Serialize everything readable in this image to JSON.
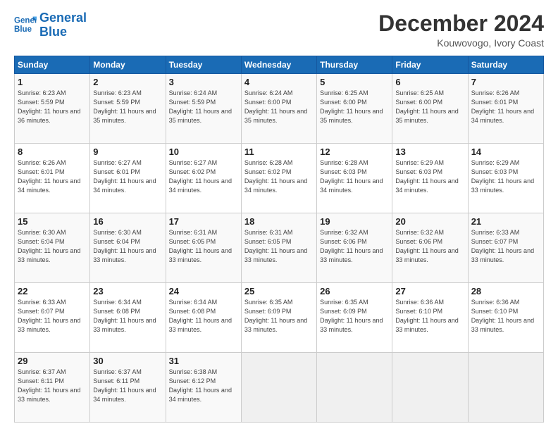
{
  "logo": {
    "line1": "General",
    "line2": "Blue"
  },
  "title": "December 2024",
  "subtitle": "Kouwovogo, Ivory Coast",
  "header": {
    "days": [
      "Sunday",
      "Monday",
      "Tuesday",
      "Wednesday",
      "Thursday",
      "Friday",
      "Saturday"
    ]
  },
  "weeks": [
    [
      {
        "day": "1",
        "sunrise": "6:23 AM",
        "sunset": "5:59 PM",
        "daylight": "11 hours and 36 minutes."
      },
      {
        "day": "2",
        "sunrise": "6:23 AM",
        "sunset": "5:59 PM",
        "daylight": "11 hours and 35 minutes."
      },
      {
        "day": "3",
        "sunrise": "6:24 AM",
        "sunset": "5:59 PM",
        "daylight": "11 hours and 35 minutes."
      },
      {
        "day": "4",
        "sunrise": "6:24 AM",
        "sunset": "6:00 PM",
        "daylight": "11 hours and 35 minutes."
      },
      {
        "day": "5",
        "sunrise": "6:25 AM",
        "sunset": "6:00 PM",
        "daylight": "11 hours and 35 minutes."
      },
      {
        "day": "6",
        "sunrise": "6:25 AM",
        "sunset": "6:00 PM",
        "daylight": "11 hours and 35 minutes."
      },
      {
        "day": "7",
        "sunrise": "6:26 AM",
        "sunset": "6:01 PM",
        "daylight": "11 hours and 34 minutes."
      }
    ],
    [
      {
        "day": "8",
        "sunrise": "6:26 AM",
        "sunset": "6:01 PM",
        "daylight": "11 hours and 34 minutes."
      },
      {
        "day": "9",
        "sunrise": "6:27 AM",
        "sunset": "6:01 PM",
        "daylight": "11 hours and 34 minutes."
      },
      {
        "day": "10",
        "sunrise": "6:27 AM",
        "sunset": "6:02 PM",
        "daylight": "11 hours and 34 minutes."
      },
      {
        "day": "11",
        "sunrise": "6:28 AM",
        "sunset": "6:02 PM",
        "daylight": "11 hours and 34 minutes."
      },
      {
        "day": "12",
        "sunrise": "6:28 AM",
        "sunset": "6:03 PM",
        "daylight": "11 hours and 34 minutes."
      },
      {
        "day": "13",
        "sunrise": "6:29 AM",
        "sunset": "6:03 PM",
        "daylight": "11 hours and 34 minutes."
      },
      {
        "day": "14",
        "sunrise": "6:29 AM",
        "sunset": "6:03 PM",
        "daylight": "11 hours and 33 minutes."
      }
    ],
    [
      {
        "day": "15",
        "sunrise": "6:30 AM",
        "sunset": "6:04 PM",
        "daylight": "11 hours and 33 minutes."
      },
      {
        "day": "16",
        "sunrise": "6:30 AM",
        "sunset": "6:04 PM",
        "daylight": "11 hours and 33 minutes."
      },
      {
        "day": "17",
        "sunrise": "6:31 AM",
        "sunset": "6:05 PM",
        "daylight": "11 hours and 33 minutes."
      },
      {
        "day": "18",
        "sunrise": "6:31 AM",
        "sunset": "6:05 PM",
        "daylight": "11 hours and 33 minutes."
      },
      {
        "day": "19",
        "sunrise": "6:32 AM",
        "sunset": "6:06 PM",
        "daylight": "11 hours and 33 minutes."
      },
      {
        "day": "20",
        "sunrise": "6:32 AM",
        "sunset": "6:06 PM",
        "daylight": "11 hours and 33 minutes."
      },
      {
        "day": "21",
        "sunrise": "6:33 AM",
        "sunset": "6:07 PM",
        "daylight": "11 hours and 33 minutes."
      }
    ],
    [
      {
        "day": "22",
        "sunrise": "6:33 AM",
        "sunset": "6:07 PM",
        "daylight": "11 hours and 33 minutes."
      },
      {
        "day": "23",
        "sunrise": "6:34 AM",
        "sunset": "6:08 PM",
        "daylight": "11 hours and 33 minutes."
      },
      {
        "day": "24",
        "sunrise": "6:34 AM",
        "sunset": "6:08 PM",
        "daylight": "11 hours and 33 minutes."
      },
      {
        "day": "25",
        "sunrise": "6:35 AM",
        "sunset": "6:09 PM",
        "daylight": "11 hours and 33 minutes."
      },
      {
        "day": "26",
        "sunrise": "6:35 AM",
        "sunset": "6:09 PM",
        "daylight": "11 hours and 33 minutes."
      },
      {
        "day": "27",
        "sunrise": "6:36 AM",
        "sunset": "6:10 PM",
        "daylight": "11 hours and 33 minutes."
      },
      {
        "day": "28",
        "sunrise": "6:36 AM",
        "sunset": "6:10 PM",
        "daylight": "11 hours and 33 minutes."
      }
    ],
    [
      {
        "day": "29",
        "sunrise": "6:37 AM",
        "sunset": "6:11 PM",
        "daylight": "11 hours and 33 minutes."
      },
      {
        "day": "30",
        "sunrise": "6:37 AM",
        "sunset": "6:11 PM",
        "daylight": "11 hours and 34 minutes."
      },
      {
        "day": "31",
        "sunrise": "6:38 AM",
        "sunset": "6:12 PM",
        "daylight": "11 hours and 34 minutes."
      },
      null,
      null,
      null,
      null
    ]
  ]
}
